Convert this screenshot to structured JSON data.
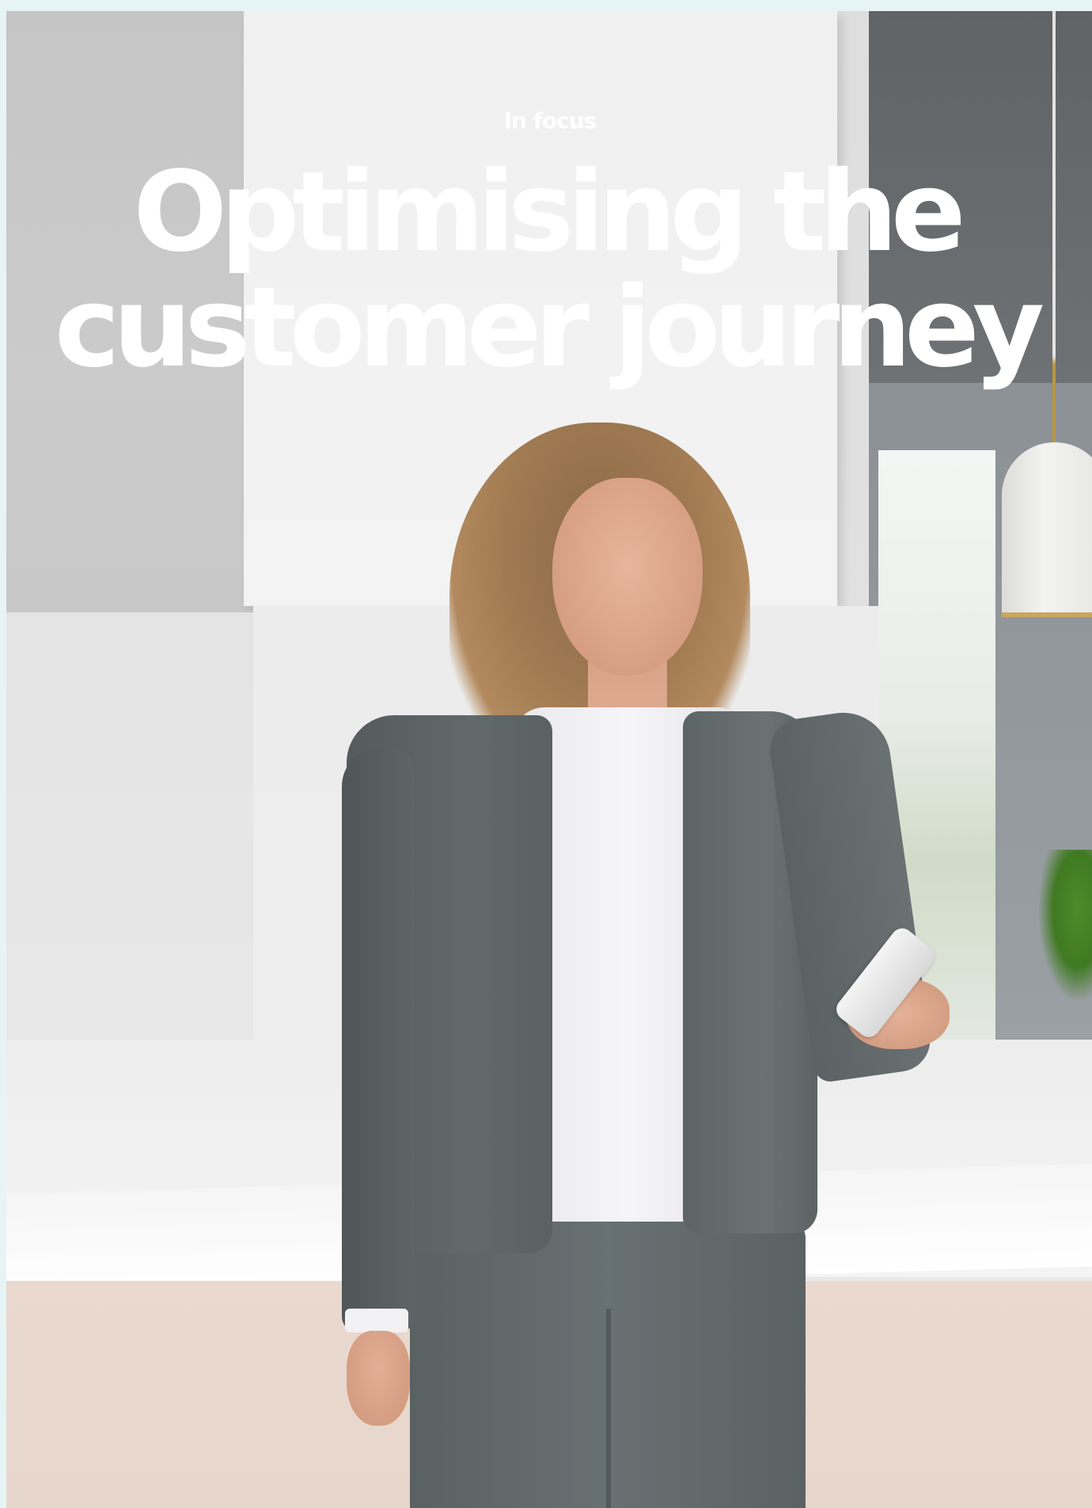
{
  "section": {
    "kicker": "In focus"
  },
  "headline": {
    "line1": "Optimising the",
    "line2": "customer journey"
  },
  "colors": {
    "page_border": "#e6f4f6",
    "headline_text": "#ffffff",
    "jacket": "#5f6668",
    "shirt": "#f2f1f3"
  }
}
